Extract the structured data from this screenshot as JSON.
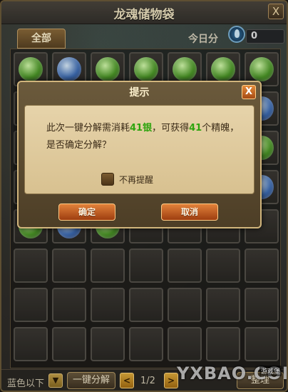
{
  "window": {
    "title": "龙魂储物袋",
    "close_label": "X"
  },
  "header": {
    "tab_all": "全部",
    "today_label": "今日分",
    "today_count": "0"
  },
  "grid": {
    "rows": [
      [
        "green",
        "blue",
        "green",
        "green",
        "green",
        "green",
        "green"
      ],
      [
        "green",
        "green",
        "green",
        "green",
        "green",
        "green",
        "blue"
      ],
      [
        "green",
        "green",
        "green",
        "green",
        "green",
        "green",
        "green"
      ],
      [
        "blue",
        "green",
        "green",
        "green",
        "green",
        "green",
        "blue"
      ],
      [
        "green",
        "blue",
        "green",
        "empty",
        "empty",
        "empty",
        "empty"
      ],
      [
        "empty",
        "empty",
        "empty",
        "empty",
        "empty",
        "empty",
        "empty"
      ],
      [
        "empty",
        "empty",
        "empty",
        "empty",
        "empty",
        "empty",
        "empty"
      ],
      [
        "empty",
        "empty",
        "empty",
        "empty",
        "empty",
        "empty",
        "empty"
      ]
    ]
  },
  "bottom": {
    "filter_label": "蓝色以下",
    "filter_arrow": "▼",
    "decompose_label": "一键分解",
    "prev_label": "<",
    "next_label": ">",
    "page": "1/2",
    "right_button": "整理"
  },
  "watermark": {
    "text": "YXBAO.COM",
    "sub": "游戏堡"
  },
  "dialog": {
    "title": "提示",
    "close_label": "X",
    "msg_part1": "此次一键分解需消耗",
    "cost": "41银",
    "msg_part2": "，可获得",
    "gain": "41",
    "msg_part3": "个精魄，是否确定分解？",
    "checkbox_label": "不再提醒",
    "ok_label": "确定",
    "cancel_label": "取消"
  }
}
